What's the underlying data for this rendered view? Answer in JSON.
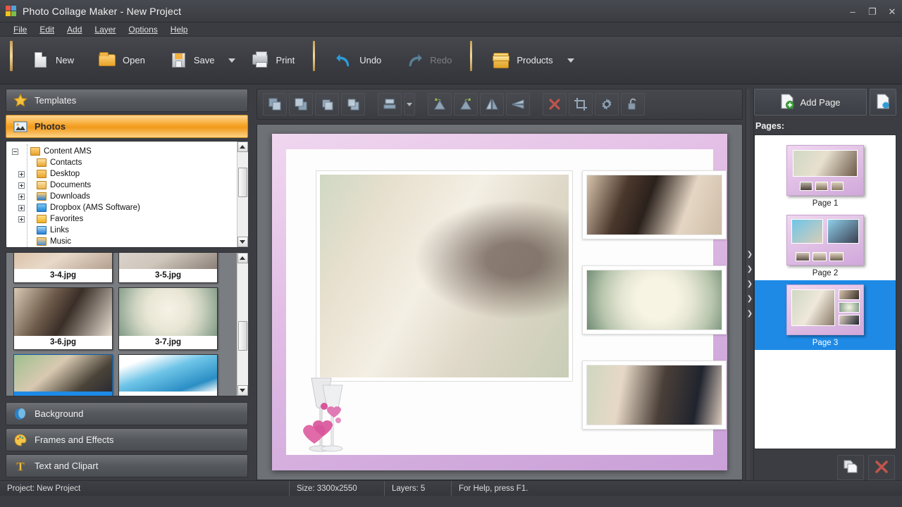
{
  "window": {
    "title": "Photo Collage Maker - New Project",
    "app_icon": "collage-app-icon",
    "minimize": "–",
    "maximize": "❐",
    "close": "✕"
  },
  "menu": [
    {
      "label": "File",
      "accel": "F"
    },
    {
      "label": "Edit",
      "accel": "E"
    },
    {
      "label": "Add",
      "accel": "A"
    },
    {
      "label": "Layer",
      "accel": "L"
    },
    {
      "label": "Options",
      "accel": "O"
    },
    {
      "label": "Help",
      "accel": "H"
    }
  ],
  "toolbar": {
    "new": "New",
    "open": "Open",
    "save": "Save",
    "print": "Print",
    "undo": "Undo",
    "redo": "Redo",
    "products": "Products"
  },
  "sidebar": {
    "sections": [
      {
        "label": "Templates",
        "icon": "star-icon",
        "active": false
      },
      {
        "label": "Photos",
        "icon": "photo-icon",
        "active": true
      },
      {
        "label": "Background",
        "icon": "background-icon",
        "active": false
      },
      {
        "label": "Frames and Effects",
        "icon": "palette-icon",
        "active": false
      },
      {
        "label": "Text and Clipart",
        "icon": "text-icon",
        "active": false
      }
    ],
    "tree": [
      {
        "label": "Content AMS",
        "indent": 0,
        "expander": "minus",
        "icon": "user-folder-icon"
      },
      {
        "label": "Contacts",
        "indent": 1,
        "expander": "none",
        "icon": "contacts-folder-icon"
      },
      {
        "label": "Desktop",
        "indent": 1,
        "expander": "plus",
        "icon": "desktop-folder-icon"
      },
      {
        "label": "Documents",
        "indent": 1,
        "expander": "plus",
        "icon": "documents-folder-icon"
      },
      {
        "label": "Downloads",
        "indent": 1,
        "expander": "plus",
        "icon": "downloads-folder-icon"
      },
      {
        "label": "Dropbox (AMS Software)",
        "indent": 1,
        "expander": "plus",
        "icon": "dropbox-folder-icon"
      },
      {
        "label": "Favorites",
        "indent": 1,
        "expander": "plus",
        "icon": "favorites-folder-icon"
      },
      {
        "label": "Links",
        "indent": 1,
        "expander": "none",
        "icon": "links-folder-icon"
      },
      {
        "label": "Music",
        "indent": 1,
        "expander": "none",
        "icon": "music-folder-icon"
      }
    ],
    "thumbnails": [
      {
        "name": "3-4.jpg",
        "selected": false
      },
      {
        "name": "3-5.jpg",
        "selected": false
      },
      {
        "name": "3-6.jpg",
        "selected": false
      },
      {
        "name": "3-7.jpg",
        "selected": false
      },
      {
        "name": "",
        "selected": true
      },
      {
        "name": "",
        "selected": false
      }
    ]
  },
  "editor_toolbar": {
    "buttons": [
      {
        "name": "bring-to-front-button",
        "icon": "bring-to-front-icon"
      },
      {
        "name": "send-to-back-button",
        "icon": "send-to-back-icon"
      },
      {
        "name": "bring-forward-button",
        "icon": "bring-forward-icon"
      },
      {
        "name": "send-backward-button",
        "icon": "send-backward-icon"
      },
      {
        "name": "align-button",
        "icon": "align-icon"
      },
      {
        "name": "align-dropdown-button",
        "icon": "chevron-down-icon"
      },
      {
        "name": "rotate-left-button",
        "icon": "rotate-left-icon"
      },
      {
        "name": "rotate-right-button",
        "icon": "rotate-right-icon"
      },
      {
        "name": "flip-horizontal-button",
        "icon": "flip-horizontal-icon"
      },
      {
        "name": "flip-vertical-button",
        "icon": "flip-vertical-icon"
      },
      {
        "name": "delete-object-button",
        "icon": "red-cross-icon"
      },
      {
        "name": "crop-button",
        "icon": "crop-icon"
      },
      {
        "name": "properties-button",
        "icon": "gear-icon"
      },
      {
        "name": "lock-button",
        "icon": "unlock-icon"
      }
    ]
  },
  "pages_panel": {
    "add_page": "Add Page",
    "page_settings_icon": "page-settings-icon",
    "pages_label": "Pages:",
    "pages": [
      {
        "label": "Page 1",
        "selected": false
      },
      {
        "label": "Page 2",
        "selected": false
      },
      {
        "label": "Page 3",
        "selected": true
      }
    ],
    "duplicate_page_icon": "duplicate-page-icon",
    "delete_page_icon": "delete-page-icon"
  },
  "statusbar": {
    "project": "Project: New Project",
    "size": "Size: 3300x2550",
    "layers": "Layers: 5",
    "help": "For Help, press F1."
  },
  "colors": {
    "accent_orange": "#f5a328",
    "selection_blue": "#1e8ae6",
    "chrome_dark": "#3b3d42",
    "page_pink": "#d8b2e0",
    "delete_red": "#c0392b"
  }
}
